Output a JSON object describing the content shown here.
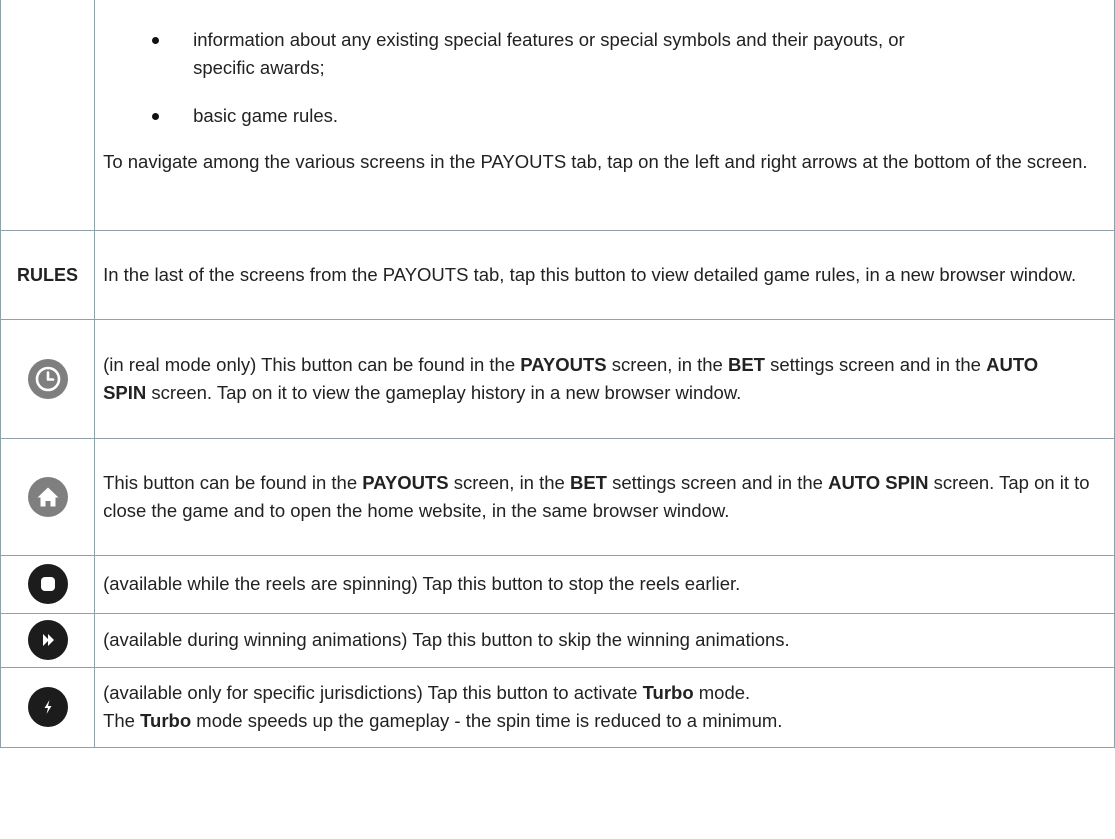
{
  "intro": {
    "bullets": [
      "information about any existing special features or special symbols and their payouts, or specific awards;",
      "basic game rules."
    ],
    "navigate_text": "To navigate among the various screens in the PAYOUTS tab, tap on the left and right arrows at the bottom of the screen."
  },
  "rows": {
    "rules": {
      "label": "RULES",
      "text": "In the last of the screens from the PAYOUTS tab, tap this button to view detailed game rules, in a new browser window."
    },
    "history": {
      "icon": "clock-icon",
      "t1": "(in real mode only) This button can be found in the ",
      "b1": "PAYOUTS",
      "t2": " screen, in the ",
      "b2": "BET",
      "t3": " settings screen and in the ",
      "b3": "AUTO SPIN",
      "t4": " screen. Tap on it to view the gameplay history in a new browser window."
    },
    "home": {
      "icon": "home-icon",
      "t1": "This button can be found in the ",
      "b1": "PAYOUTS",
      "t2": " screen, in the ",
      "b2": "BET",
      "t3": " settings screen and in the ",
      "b3": "AUTO SPIN",
      "t4": " screen. Tap on it to close the game and to open the home website, in the same browser window."
    },
    "stop": {
      "icon": "stop-icon",
      "text": "(available while the reels are spinning) Tap this button to stop the reels earlier."
    },
    "skip": {
      "icon": "skip-icon",
      "text": "(available during winning animations) Tap this button to skip the winning animations."
    },
    "turbo": {
      "icon": "lightning-icon",
      "line1_pre": "(available only for specific jurisdictions) Tap this button to activate ",
      "line1_bold": "Turbo",
      "line1_post": " mode.",
      "line2_pre": "The ",
      "line2_bold": "Turbo",
      "line2_post": " mode speeds up the gameplay - the spin time is reduced to a minimum."
    }
  },
  "colors": {
    "border": "#8fa1a9",
    "gray_icon": "#7f7f7f",
    "dark_icon": "#1c1c1c"
  }
}
